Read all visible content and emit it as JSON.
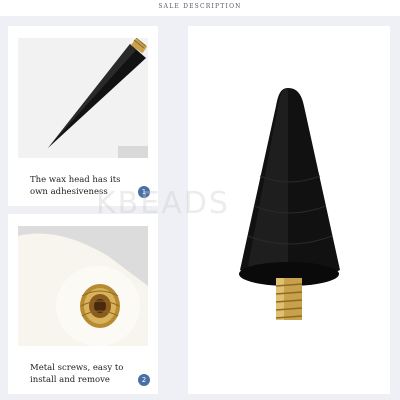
{
  "header": {
    "title": "SALE DESCRIPTION"
  },
  "cards": [
    {
      "caption": "The wax head has its own adhesiveness",
      "badge": "1"
    },
    {
      "caption": "Metal screws, easy to install and remove",
      "badge": "2"
    }
  ],
  "watermark": "KBEADS",
  "icons": {
    "badge_1": "number-badge-icon",
    "badge_2": "number-badge-icon"
  },
  "colors": {
    "background": "#eef0f5",
    "badge": "#4a6fa5",
    "wax": "#111111",
    "brass": "#c9a14a"
  }
}
